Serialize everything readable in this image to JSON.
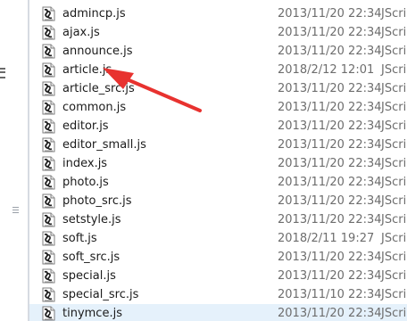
{
  "files": [
    {
      "name": "admincp.js",
      "date": "2013/11/20 22:34",
      "type": "JScri"
    },
    {
      "name": "ajax.js",
      "date": "2013/11/20 22:34",
      "type": "JScri"
    },
    {
      "name": "announce.js",
      "date": "2013/11/20 22:34",
      "type": "JScri"
    },
    {
      "name": "article.js",
      "date": "2018/2/12 12:01",
      "type": "JScri"
    },
    {
      "name": "article_src.js",
      "date": "2013/11/20 22:34",
      "type": "JScri"
    },
    {
      "name": "common.js",
      "date": "2013/11/20 22:34",
      "type": "JScri"
    },
    {
      "name": "editor.js",
      "date": "2013/11/20 22:34",
      "type": "JScri"
    },
    {
      "name": "editor_small.js",
      "date": "2013/11/20 22:34",
      "type": "JScri"
    },
    {
      "name": "index.js",
      "date": "2013/11/20 22:34",
      "type": "JScri"
    },
    {
      "name": "photo.js",
      "date": "2013/11/20 22:34",
      "type": "JScri"
    },
    {
      "name": "photo_src.js",
      "date": "2013/11/20 22:34",
      "type": "JScri"
    },
    {
      "name": "setstyle.js",
      "date": "2013/11/20 22:34",
      "type": "JScri"
    },
    {
      "name": "soft.js",
      "date": "2018/2/11 19:27",
      "type": "JScri"
    },
    {
      "name": "soft_src.js",
      "date": "2013/11/20 22:34",
      "type": "JScri"
    },
    {
      "name": "special.js",
      "date": "2013/11/20 22:34",
      "type": "JScri"
    },
    {
      "name": "special_src.js",
      "date": "2013/11/10 22:34",
      "type": "JScri"
    },
    {
      "name": "tinymce.js",
      "date": "2013/11/20 22:34",
      "type": "JScri"
    }
  ],
  "selected_file": "tinymce.js",
  "file_icon": "js-script-file-icon",
  "arrow_color": "#e8322f"
}
